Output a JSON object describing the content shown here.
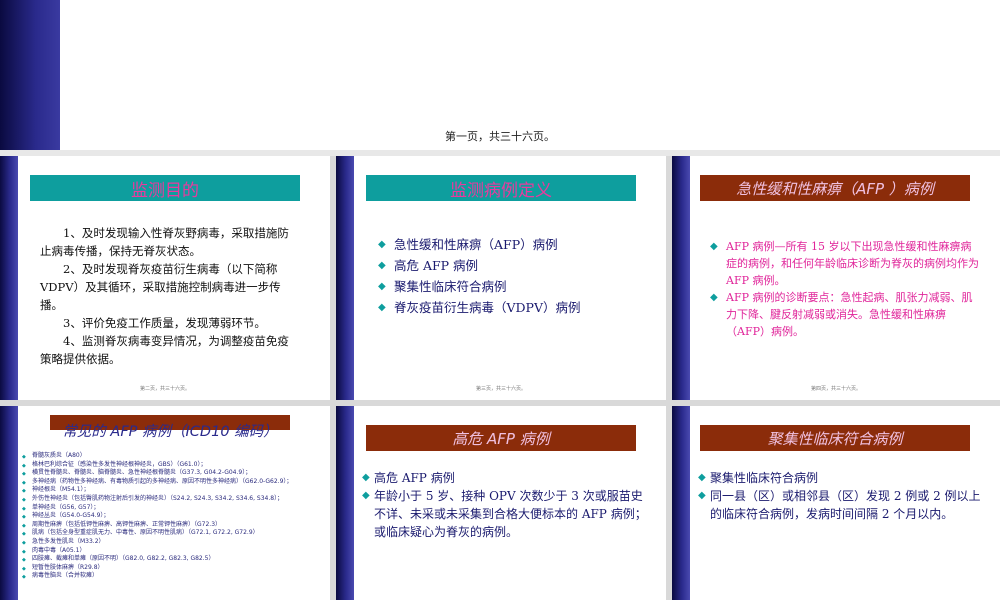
{
  "top": {
    "caption": "第一页，共三十六页。"
  },
  "slide1": {
    "title": "监测目的",
    "paragraphs": [
      "　　1、及时发现输入性脊灰野病毒，采取措施防止病毒传播，保持无脊灰状态。",
      "　　2、及时发现脊灰疫苗衍生病毒（以下简称VDPV）及其循环，采取措施控制病毒进一步传播。",
      "　　3、评价免疫工作质量，发现薄弱环节。",
      "　　4、监测脊灰病毒变异情况，为调整疫苗免疫策略提供依据。"
    ],
    "footer": "第二页，共三十六页。"
  },
  "slide2": {
    "title": "监测病例定义",
    "items": [
      "急性缓和性麻痹（AFP）病例",
      "高危 AFP 病例",
      "聚集性临床符合病例",
      "脊灰疫苗衍生病毒（VDPV）病例"
    ],
    "footer": "第三页，共三十六页。"
  },
  "slide3": {
    "title": "急性缓和性麻痹（AFP ）病例",
    "items": [
      "AFP 病例—所有 15 岁以下出现急性缓和性麻痹病症的病例，和任何年龄临床诊断为脊灰的病例均作为 AFP 病例。",
      "AFP 病例的诊断要点：急性起病、肌张力减弱、肌力下降、腱反射减弱或消失。急性缓和性麻痹（AFP）病例。"
    ],
    "footer": "第四页，共三十六页。"
  },
  "slide4": {
    "title": "常见的 AFP 病例（ICD10 编码）",
    "items": [
      "脊髓灰质炎（A80）",
      "格林巴利综合征（感染性多发性神经根神经炎，GBS）（G61.0）；",
      "横贯性脊髓炎、脊髓炎、脑脊髓炎、急性神经根脊髓炎（G37.3, G04.2-G04.9）；",
      "多神经病（药物性多神经病、有毒物质引起的多神经病、原因不明性多神经病）（G62.0-G62.9）；",
      "神经根炎（M54.1）；",
      "外伤性神经炎（包括臀肌药物注射后引发的神经炎）（S24.2, S24.3, S34.2, S34.6, S34.8）；",
      "单神经炎（G56, G57）；",
      "神经丛炎（G54.0-G54.9）；",
      "周期性麻痹（包括低钾性麻痹、高钾性麻痹、正常钾性麻痹）（G72.3）",
      "肌病（包括全身型重症肌无力、中毒性、原因不明性肌病）（G72.1, G72.2, G72.9）",
      "急性多发性肌炎（M33.2）",
      "肉毒中毒（A05.1）",
      "四肢瘫、截瘫和单瘫（原因不明）（G82.0, G82.2, G82.3, G82.5）",
      "短暂性肢体麻痹（R29.8）",
      "病毒性脑炎（合并软瘫）"
    ]
  },
  "slide5": {
    "title": "高危 AFP 病例",
    "items": [
      "高危 AFP 病例",
      "年龄小于 5 岁、接种 OPV 次数少于 3 次或服苗史不详、未采或未采集到合格大便标本的 AFP 病例；或临床疑心为脊灰的病例。"
    ]
  },
  "slide6": {
    "title": "聚集性临床符合病例",
    "items": [
      "聚集性临床符合病例",
      "同一县（区）或相邻县（区）发现 2 例或 2 例以上的临床符合病例，发病时间间隔 2 个月以内。"
    ]
  },
  "colors": {
    "teal": "#0e9e9e",
    "brown": "#8b2c0a",
    "pink": "#e83a9e",
    "navy": "#2a2a8c"
  },
  "icons": {
    "bullet": "diamond-bullet-icon"
  }
}
